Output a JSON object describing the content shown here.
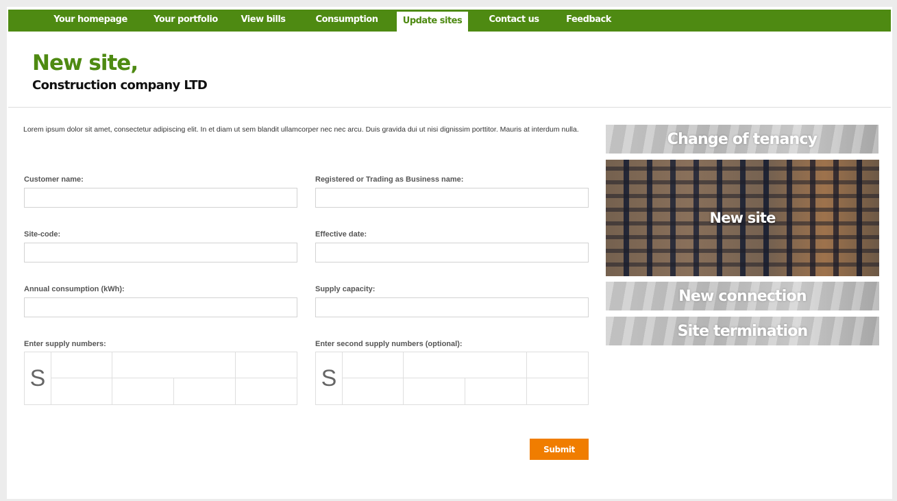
{
  "nav": {
    "items": [
      {
        "label": "Your homepage"
      },
      {
        "label": "Your portfolio"
      },
      {
        "label": "View bills"
      },
      {
        "label": "Consumption"
      },
      {
        "label": "Update sites"
      },
      {
        "label": "Contact us"
      },
      {
        "label": "Feedback"
      }
    ],
    "active": "Update sites"
  },
  "header": {
    "title": "New site,",
    "subtitle": "Construction company LTD"
  },
  "intro": "Lorem ipsum dolor sit amet, consectetur adipiscing elit. In et diam ut sem blandit ullamcorper nec nec arcu. Duis gravida dui ut nisi dignissim porttitor. Mauris at interdum nulla.",
  "form": {
    "customer_name": {
      "label": "Customer name:",
      "value": ""
    },
    "business_name": {
      "label": "Registered or Trading as Business name:",
      "value": ""
    },
    "site_code": {
      "label": "Site-code:",
      "value": ""
    },
    "effective_date": {
      "label": "Effective date:",
      "value": ""
    },
    "annual_consumption": {
      "label": "Annual consumption (kWh):",
      "value": ""
    },
    "supply_capacity": {
      "label": "Supply capacity:",
      "value": ""
    },
    "supply_numbers": {
      "label": "Enter supply numbers:",
      "prefix": "S"
    },
    "second_supply_numbers": {
      "label": "Enter second supply numbers (optional):",
      "prefix": "S"
    },
    "submit_label": "Submit"
  },
  "side_panels": [
    {
      "label": "Change of tenancy"
    },
    {
      "label": "New site"
    },
    {
      "label": "New connection"
    },
    {
      "label": "Site termination"
    }
  ],
  "colors": {
    "brand_green": "#4e8a12",
    "submit_orange": "#f07d00"
  }
}
